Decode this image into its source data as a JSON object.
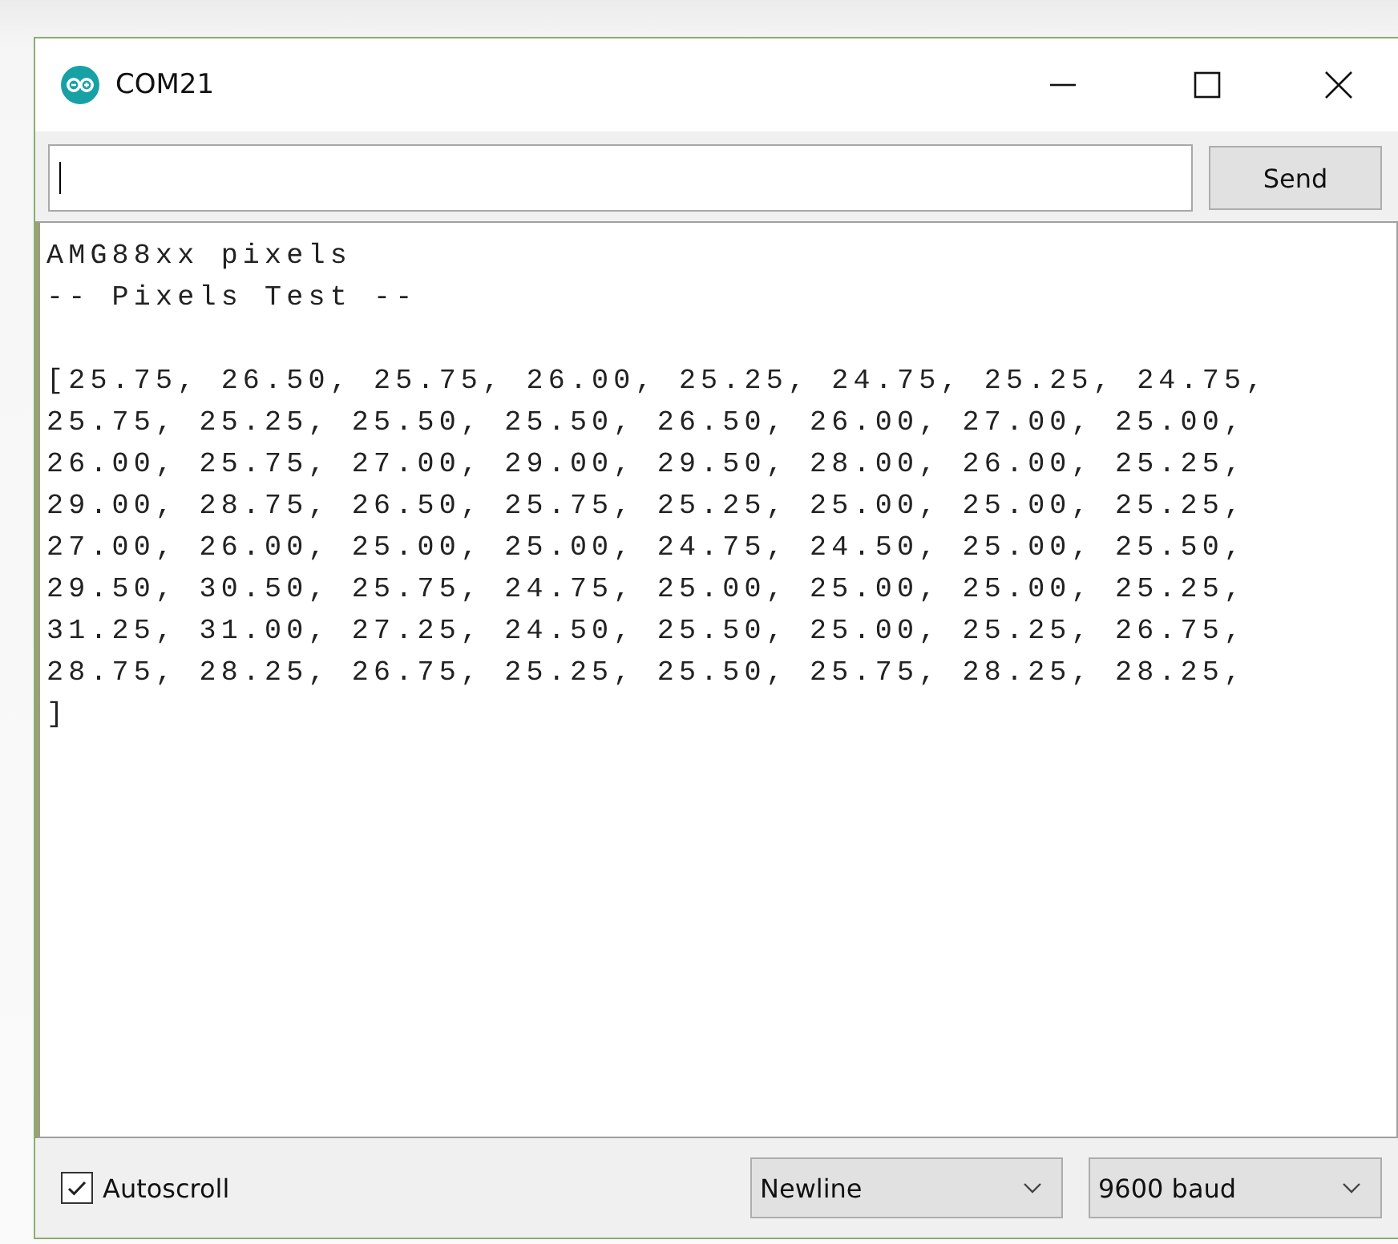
{
  "window": {
    "title": "COM21"
  },
  "input": {
    "send_label": "Send"
  },
  "output": {
    "blocks": [
      [
        "AMG88xx pixels",
        "-- Pixels Test --"
      ],
      [
        "[25.75, 26.50, 25.75, 26.00, 25.25, 24.75, 25.25, 24.75,",
        "25.75, 25.25, 25.50, 25.50, 26.50, 26.00, 27.00, 25.00,",
        "26.00, 25.75, 27.00, 29.00, 29.50, 28.00, 26.00, 25.25,",
        "29.00, 28.75, 26.50, 25.75, 25.25, 25.00, 25.00, 25.25,",
        "27.00, 26.00, 25.00, 25.00, 24.75, 24.50, 25.00, 25.50,",
        "29.50, 30.50, 25.75, 24.75, 25.00, 25.00, 25.00, 25.25,",
        "31.25, 31.00, 27.25, 24.50, 25.50, 25.00, 25.25, 26.75,",
        "28.75, 28.25, 26.75, 25.25, 25.50, 25.75, 28.25, 28.25,",
        "]"
      ]
    ]
  },
  "footer": {
    "autoscroll": {
      "label": "Autoscroll",
      "checked": true
    },
    "line_ending": "Newline",
    "baud": "9600 baud"
  }
}
